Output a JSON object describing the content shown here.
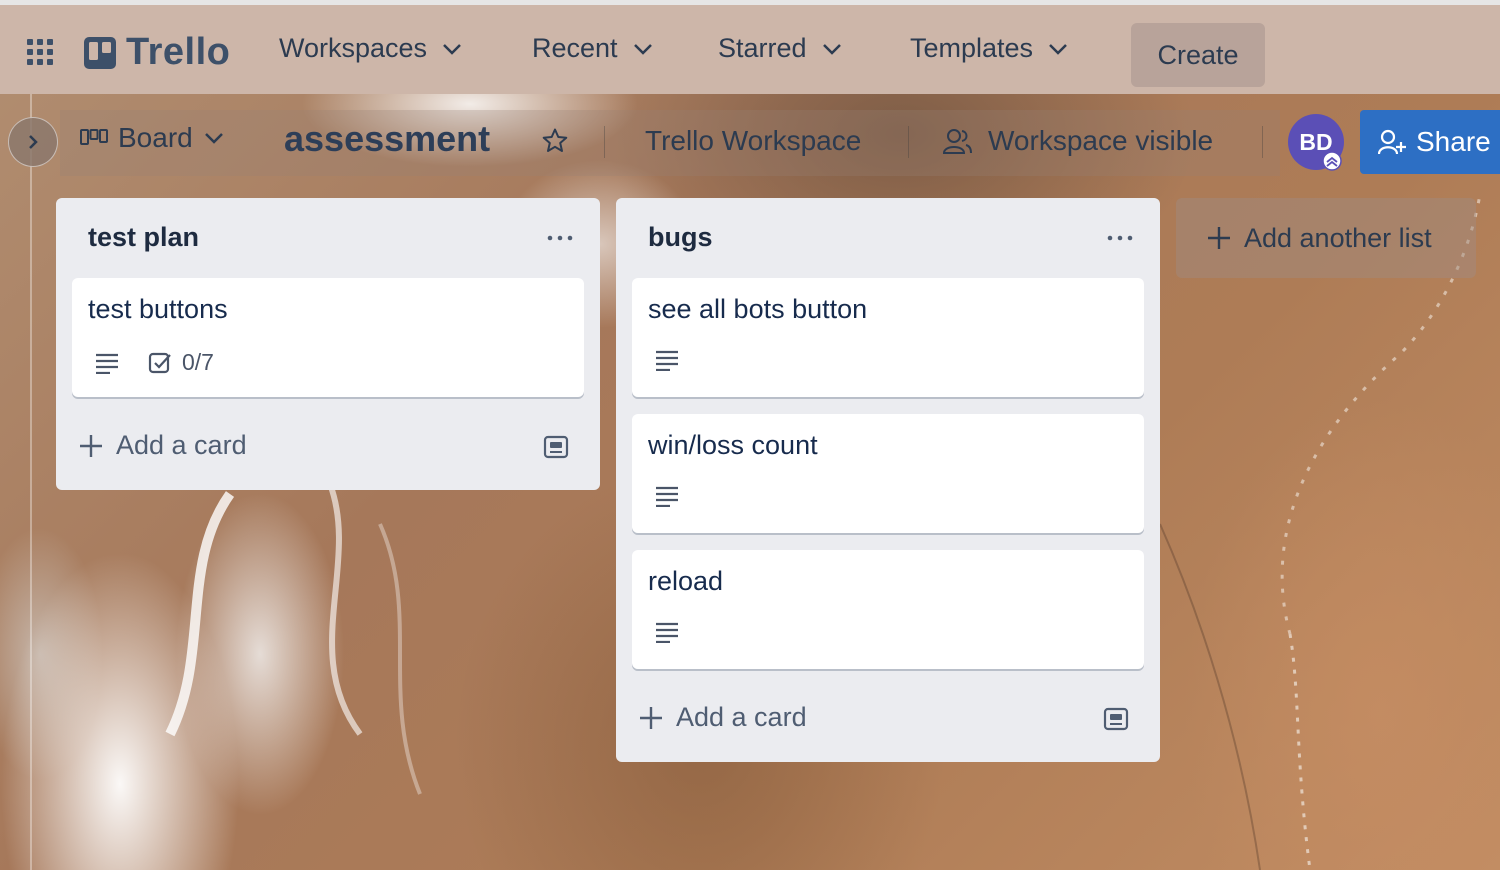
{
  "topnav": {
    "apps_icon": "grid-icon",
    "logo_text": "Trello",
    "menus": [
      {
        "label": "Workspaces"
      },
      {
        "label": "Recent"
      },
      {
        "label": "Starred"
      },
      {
        "label": "Templates"
      }
    ],
    "create_label": "Create"
  },
  "board": {
    "view_label": "Board",
    "title": "assessment",
    "workspace": "Trello Workspace",
    "visibility": "Workspace visible",
    "avatar_initials": "BD",
    "share_label": "Share"
  },
  "lists": [
    {
      "title": "test plan",
      "cards": [
        {
          "title": "test buttons",
          "has_description": true,
          "checklist": "0/7"
        }
      ],
      "add_card_label": "Add a card"
    },
    {
      "title": "bugs",
      "cards": [
        {
          "title": "see all bots button",
          "has_description": true
        },
        {
          "title": "win/loss count",
          "has_description": true
        },
        {
          "title": "reload",
          "has_description": true
        }
      ],
      "add_card_label": "Add a card"
    }
  ],
  "add_list_label": "Add another list",
  "colors": {
    "nav_bg": "#cdb6a9",
    "share_blue": "#2d6fc4",
    "avatar_purple": "#5b4fb6",
    "list_bg": "#ebecf0"
  }
}
